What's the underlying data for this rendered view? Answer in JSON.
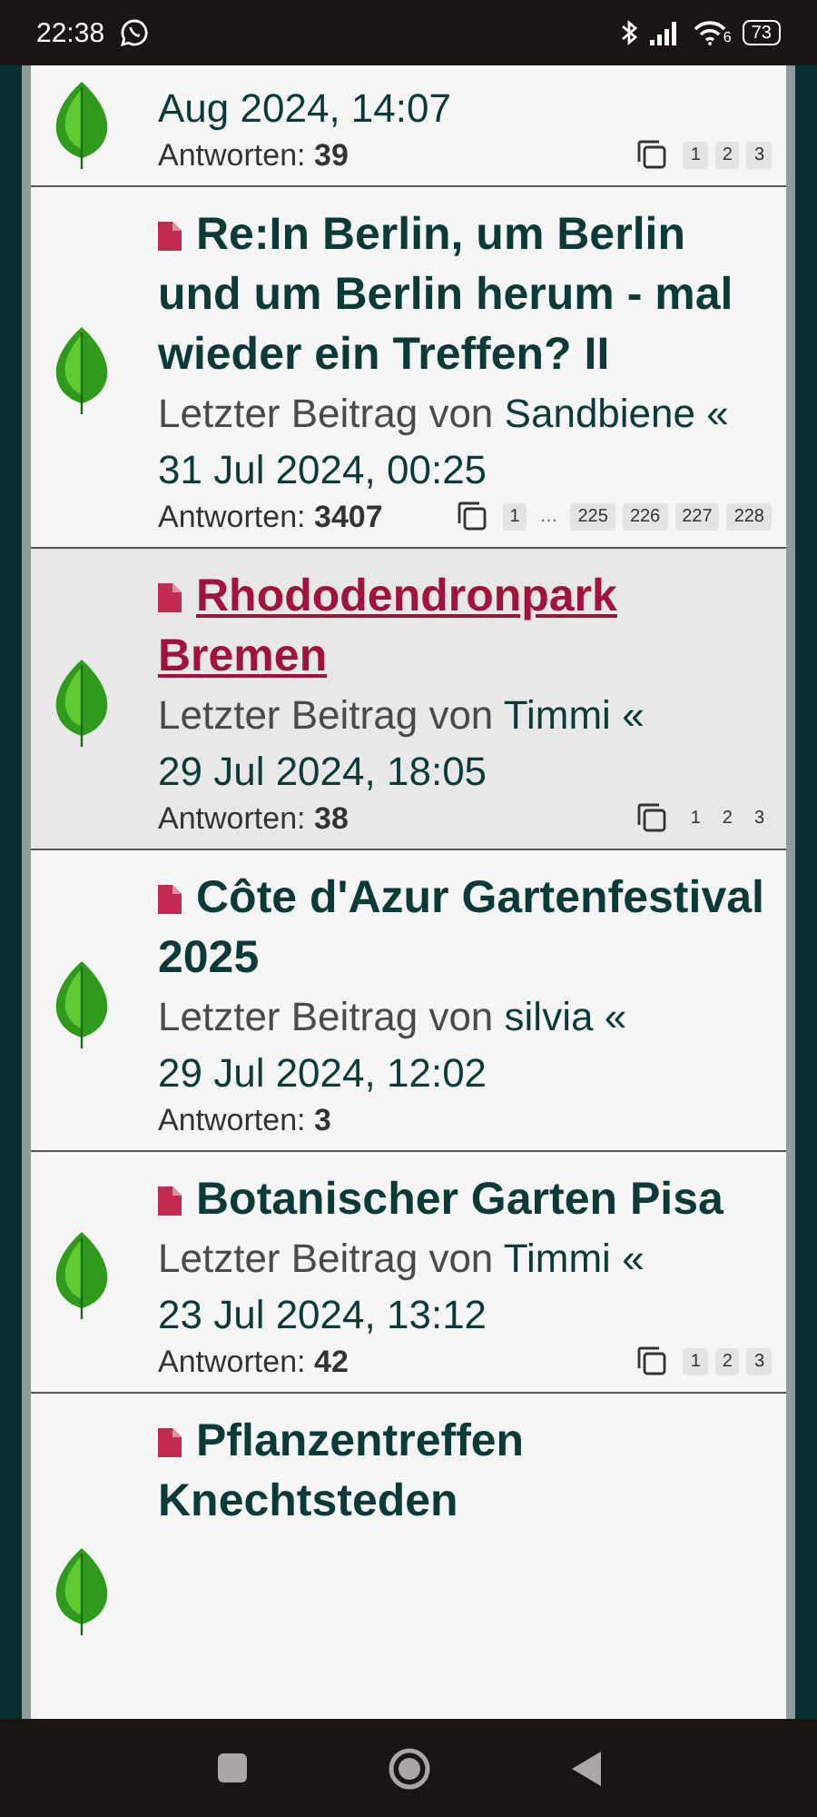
{
  "status_bar": {
    "time": "22:38",
    "wifi_badge": "6",
    "battery": "73"
  },
  "topics": [
    {
      "highlighted": false,
      "last_post": {
        "date": "Aug 2024, 14:07"
      },
      "replies_label": "Antworten:",
      "replies": "39",
      "pages": [
        {
          "kind": "page",
          "label": "1"
        },
        {
          "kind": "page",
          "label": "2"
        },
        {
          "kind": "page",
          "label": "3"
        }
      ]
    },
    {
      "title": "Re:In Berlin, um Berlin und um Berlin herum - mal wieder ein Treffen? II",
      "highlighted": false,
      "last_post": {
        "prefix": "Letzter Beitrag von",
        "author": "Sandbiene",
        "separator": "«",
        "date": "31 Jul 2024, 00:25"
      },
      "replies_label": "Antworten:",
      "replies": "3407",
      "pages": [
        {
          "kind": "page",
          "label": "1"
        },
        {
          "kind": "ellipsis",
          "label": "…"
        },
        {
          "kind": "page",
          "label": "225"
        },
        {
          "kind": "page",
          "label": "226"
        },
        {
          "kind": "page",
          "label": "227"
        },
        {
          "kind": "page",
          "label": "228"
        }
      ]
    },
    {
      "title": "Rhododendronpark Bremen",
      "highlighted": true,
      "last_post": {
        "prefix": "Letzter Beitrag von",
        "author": "Timmi",
        "separator": "«",
        "date": "29 Jul 2024, 18:05"
      },
      "replies_label": "Antworten:",
      "replies": "38",
      "pages": [
        {
          "kind": "page",
          "label": "1"
        },
        {
          "kind": "page",
          "label": "2"
        },
        {
          "kind": "page",
          "label": "3"
        }
      ]
    },
    {
      "title": "Côte d'Azur Gartenfestival 2025",
      "highlighted": false,
      "last_post": {
        "prefix": "Letzter Beitrag von",
        "author": "silvia",
        "separator": "«",
        "date": "29 Jul 2024, 12:02"
      },
      "replies_label": "Antworten:",
      "replies": "3"
    },
    {
      "title": "Botanischer Garten Pisa",
      "highlighted": false,
      "last_post": {
        "prefix": "Letzter Beitrag von",
        "author": "Timmi",
        "separator": "«",
        "date": "23 Jul 2024, 13:12"
      },
      "replies_label": "Antworten:",
      "replies": "42",
      "pages": [
        {
          "kind": "page",
          "label": "1"
        },
        {
          "kind": "page",
          "label": "2"
        },
        {
          "kind": "page",
          "label": "3"
        }
      ]
    },
    {
      "title": "Pflanzentreffen Knechtsteden",
      "highlighted": false
    }
  ]
}
